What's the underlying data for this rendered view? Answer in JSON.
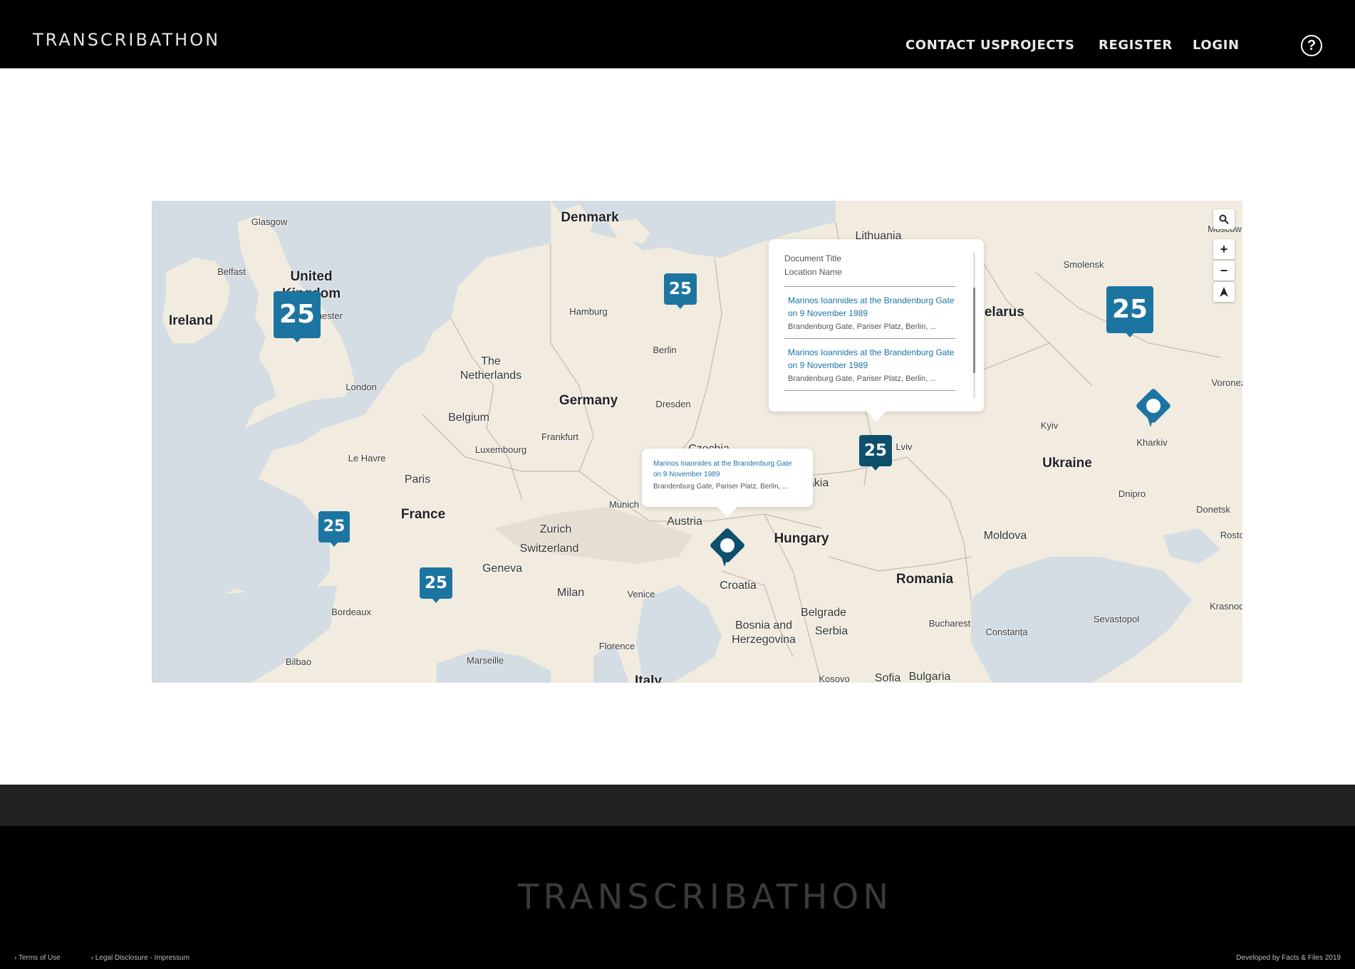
{
  "header": {
    "logo": "TRANSCRIBATHON",
    "nav": {
      "contact": "CONTACT US",
      "projects": "PROJECTS",
      "register": "REGISTER",
      "login": "LOGIN"
    },
    "help_icon": "help-circle-icon",
    "help_glyph": "?"
  },
  "map": {
    "places": {
      "glasgow": "Glasgow",
      "belfast": "Belfast",
      "united_kingdom_1": "United",
      "united_kingdom_2": "Kingdom",
      "ireland": "Ireland",
      "manchester": "Manchester",
      "london": "London",
      "denmark": "Denmark",
      "hamburg": "Hamburg",
      "berlin": "Berlin",
      "lithuania": "Lithuania",
      "smolensk": "Smolensk",
      "moscow": "Moscow",
      "belarus": "Belarus",
      "the_netherlands_1": "The",
      "the_netherlands_2": "Netherlands",
      "belgium": "Belgium",
      "germany": "Germany",
      "dresden": "Dresden",
      "luxembourg": "Luxembourg",
      "frankfurt": "Frankfurt",
      "czechia": "Czechia",
      "slovakia": "Slovakia",
      "lviv": "Lviv",
      "kyiv": "Kyiv",
      "kharkiv": "Kharkiv",
      "ukraine": "Ukraine",
      "voronezh": "Voronezh",
      "le_havre": "Le Havre",
      "paris": "Paris",
      "france": "France",
      "munich": "Munich",
      "zurich": "Zurich",
      "austria": "Austria",
      "switzerland": "Switzerland",
      "hungary": "Hungary",
      "dnipro": "Dnipro",
      "donetsk": "Donetsk",
      "rostov": "Rostov",
      "moldova": "Moldova",
      "geneva": "Geneva",
      "milan": "Milan",
      "venice": "Venice",
      "croatia": "Croatia",
      "romania": "Romania",
      "bordeaux": "Bordeaux",
      "belgrade": "Belgrade",
      "bosnia_1": "Bosnia and",
      "bosnia_2": "Herzegovina",
      "serbia": "Serbia",
      "bucharest": "Bucharest",
      "constanta": "Constanța",
      "sevastopol": "Sevastopol",
      "krasnodar": "Krasnodar",
      "florence": "Florence",
      "bilbao": "Bilbao",
      "marseille": "Marseille",
      "italy": "Italy",
      "kosovo": "Kosovo",
      "sofia": "Sofia",
      "bulgaria": "Bulgaria"
    },
    "clusters": [
      {
        "id": "uk",
        "count": "25"
      },
      {
        "id": "north-germany",
        "count": "25"
      },
      {
        "id": "russia",
        "count": "25"
      },
      {
        "id": "poland",
        "count": "25"
      },
      {
        "id": "brittany",
        "count": "25"
      },
      {
        "id": "south-france",
        "count": "25"
      }
    ],
    "controls": {
      "search": "search-icon",
      "zoom_in": "+",
      "zoom_out": "−",
      "locate": "navigation-arrow-icon"
    },
    "popup_list": {
      "header_line1": "Document Title",
      "header_line2": "Location Name",
      "items": [
        {
          "title": "Marinos Ioannides at the Brandenburg Gate on 9 November 1989",
          "location": "Brandenburg Gate, Pariser Platz, Berlin, ..."
        },
        {
          "title": "Marinos Ioannides at the Brandenburg Gate on 9 November 1989",
          "location": "Brandenburg Gate, Pariser Platz, Berlin, ..."
        }
      ]
    },
    "popup_single": {
      "title": "Marinos Ioannides at the Brandenburg Gate on 9 November 1989",
      "location": "Brandenburg Gate, Pariser Platz, Berlin, ..."
    },
    "colors": {
      "land": "#f1ecdf",
      "water": "#d3dde3",
      "cluster": "#1c75a1",
      "cluster_active": "#0e4f6e"
    }
  },
  "footer": {
    "logo": "TRANSCRIBATHON",
    "terms": "Terms of Use",
    "legal": "Legal Disclosure - Impressum",
    "credit": "Developed by Facts & Files 2019"
  }
}
